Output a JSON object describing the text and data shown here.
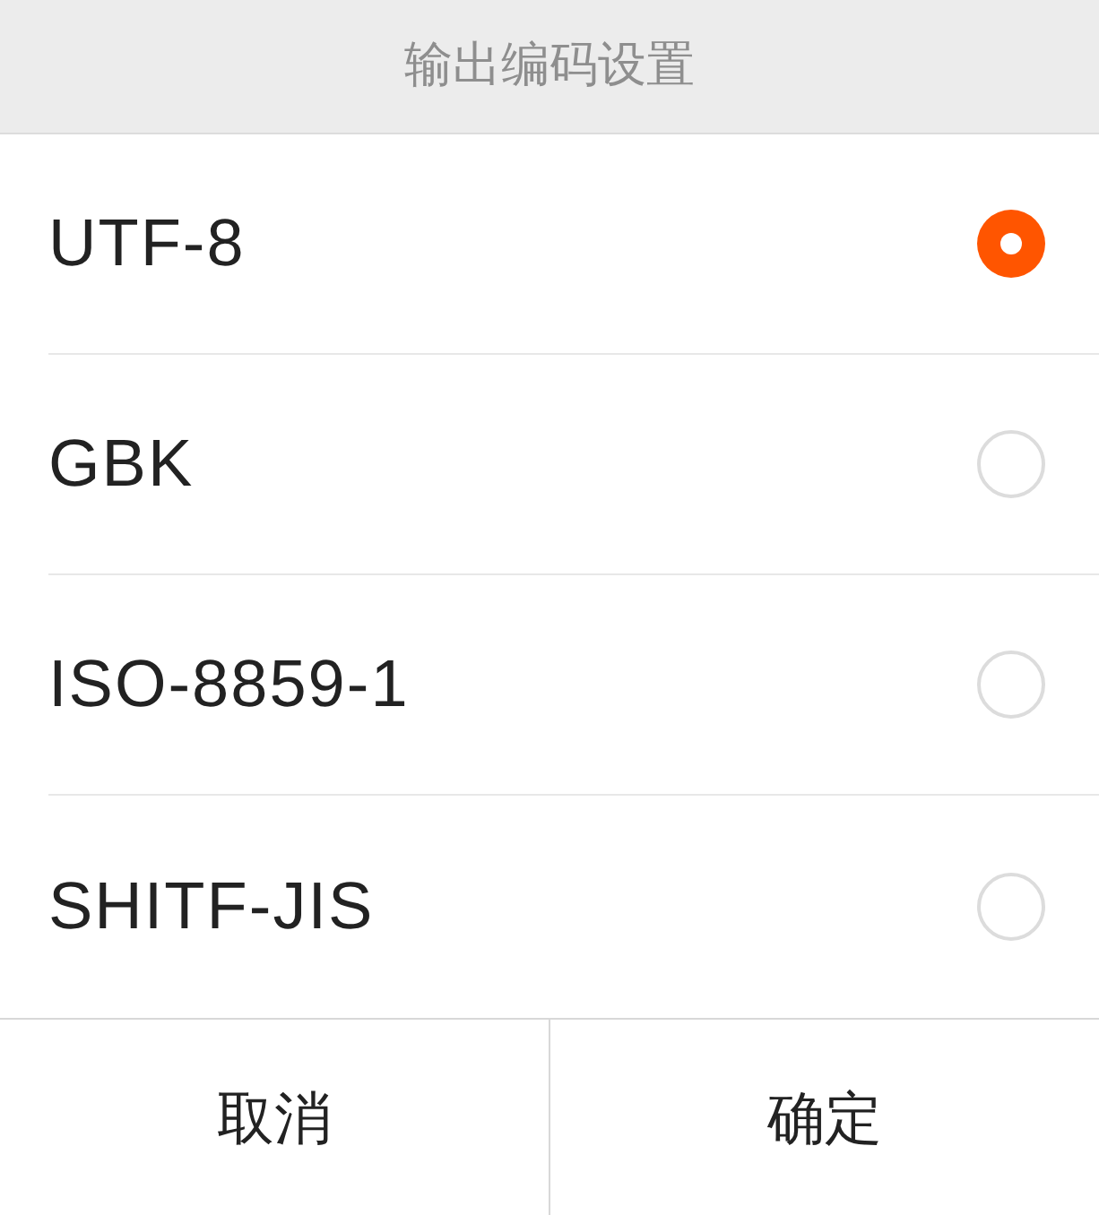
{
  "title": "输出编码设置",
  "options": [
    {
      "label": "UTF-8",
      "selected": true
    },
    {
      "label": "GBK",
      "selected": false
    },
    {
      "label": "ISO-8859-1",
      "selected": false
    },
    {
      "label": "SHITF-JIS",
      "selected": false
    }
  ],
  "buttons": [
    {
      "label": "取消"
    },
    {
      "label": "确定"
    }
  ]
}
